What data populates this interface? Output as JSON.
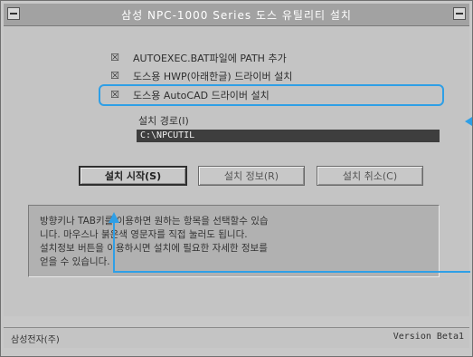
{
  "window": {
    "title": "삼성 NPC-1000 Series 도스 유틸리티 설치"
  },
  "options": [
    {
      "checked": true,
      "mark": "☒",
      "label": "AUTOEXEC.BAT파일에 PATH 추가"
    },
    {
      "checked": true,
      "mark": "☒",
      "label": "도스용 HWP(아래한글) 드라이버 설치"
    },
    {
      "checked": true,
      "mark": "☒",
      "label": "도스용 AutoCAD 드라이버 설치"
    }
  ],
  "install_path": {
    "label": "설치 경로(I)",
    "value": "C:\\NPCUTIL"
  },
  "buttons": {
    "start": "설치 시작(S)",
    "info": "설치 정보(R)",
    "cancel": "설치 취소(C)"
  },
  "help_text": "방향키나 TAB키를 이용하면 원하는 항목을 선택할수 있습\n니다. 마우스나 붉은색 영문자를 직접 눌러도 됩니다.\n설치정보 버튼을 이용하시면 설치에 필요한 자세한 정보를\n얻을 수 있습니다.",
  "status": {
    "company": "삼성전자(주)",
    "version": "Version Beta1"
  },
  "accent_color": "#2f9fe6"
}
